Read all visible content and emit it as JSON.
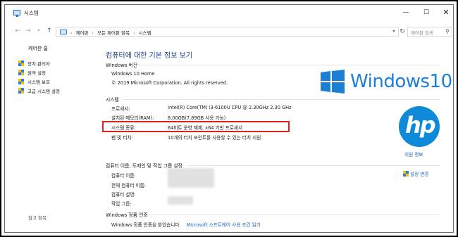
{
  "window": {
    "title": "시스템",
    "minimize_glyph": "—",
    "maximize_glyph": "☐",
    "close_glyph": "✕"
  },
  "nav": {
    "back_glyph": "←",
    "forward_glyph": "→",
    "dropdown_glyph": "▾",
    "up_glyph": "↑",
    "breadcrumbs": [
      "제어판",
      "모든 제어판 항목",
      "시스템"
    ],
    "crumb_separator": "›",
    "search_placeholder": "제어판 검색",
    "refresh_glyph": "↻",
    "search_glyph": "⚲"
  },
  "sidebar": {
    "home": "제어판 홈",
    "items": [
      {
        "label": "장치 관리자",
        "icon": "shield-icon"
      },
      {
        "label": "원격 설정",
        "icon": "shield-icon"
      },
      {
        "label": "시스템 보호",
        "icon": "shield-icon"
      },
      {
        "label": "고급 시스템 설정",
        "icon": "shield-icon"
      }
    ],
    "see_also": "참고 항목"
  },
  "main": {
    "title": "컴퓨터에 대한 기본 정보 보기",
    "edition": {
      "heading": "Windows 버전",
      "name": "Windows 10 Home",
      "copyright": "© 2019 Microsoft Corporation. All rights reserved.",
      "logo_text": "Windows10"
    },
    "system": {
      "heading": "시스템",
      "rows": [
        {
          "label": "프로세서:",
          "value": "Intel(R) Core(TM) i3-6100U CPU @ 2.30GHz   2.30 GHz"
        },
        {
          "label": "설치된 메모리(RAM):",
          "value": "8.00GB(7.89GB 사용 가능)"
        },
        {
          "label": "시스템 종류:",
          "value": "64비트 운영 체제, x64 기반 프로세서"
        },
        {
          "label": "펜 및 터치:",
          "value": "10개의 터치 포인트를 사용할 수 있는 터치 지원"
        }
      ],
      "oem_logo_text": "hp",
      "support_link": "지원 정보"
    },
    "computer_name": {
      "heading": "컴퓨터 이름, 도메인 및 작업 그룹 설정",
      "rows": [
        {
          "label": "컴퓨터 이름:"
        },
        {
          "label": "전체 컴퓨터 이름:"
        },
        {
          "label": "컴퓨터 설명:"
        },
        {
          "label": "작업 그룹:"
        }
      ],
      "change_link": "설정 변경"
    },
    "activation": {
      "heading": "Windows 정품 인증",
      "status": "Windows 정품 인증을 받았습니다.",
      "license_link": "Microsoft 소프트웨어 사용 조건 읽기"
    }
  },
  "colors": {
    "accent": "#1e3f8f",
    "link": "#1a63c6",
    "windows_blue": "#1c7fd6",
    "hp_blue": "#0f8ad8",
    "highlight": "#e11f1f"
  }
}
